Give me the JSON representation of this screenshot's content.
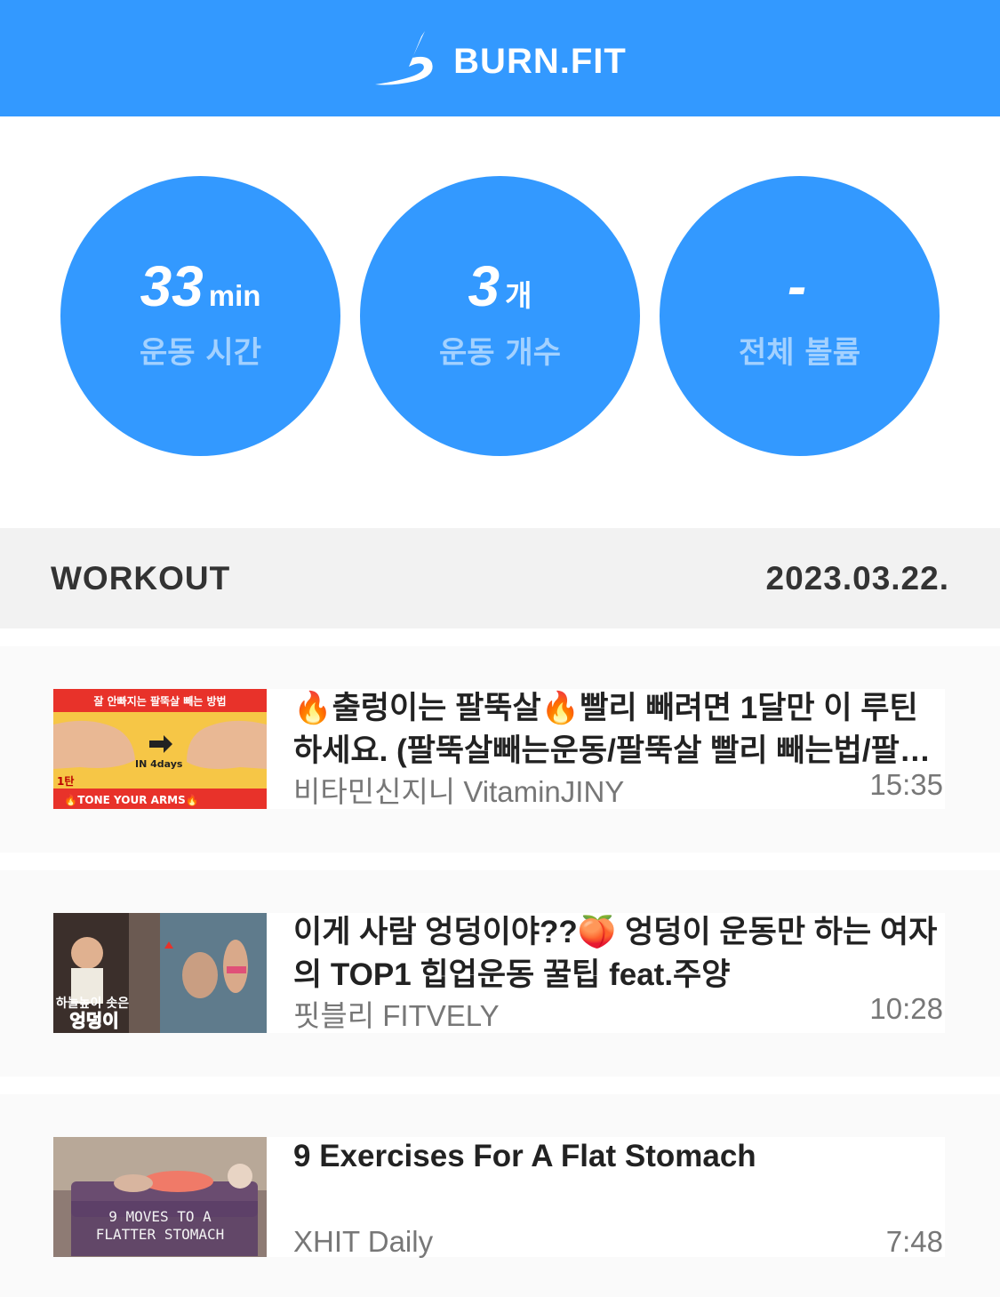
{
  "header": {
    "brand": "BURN.FIT",
    "logo_icon": "burnfit-logo-icon",
    "color": "#3399ff"
  },
  "stats": [
    {
      "value": "33",
      "unit": "min",
      "label": "운동 시간"
    },
    {
      "value": "3",
      "unit": "개",
      "label": "운동 개수"
    },
    {
      "value": "-",
      "unit": "",
      "label": "전체 볼륨"
    }
  ],
  "section": {
    "title": "WORKOUT",
    "date": "2023.03.22."
  },
  "videos": [
    {
      "title": "🔥출렁이는 팔뚝살🔥빨리 빼려면 1달만 이 루틴 하세요. (팔뚝살빼는운동/팔뚝살 빨리 빼는법/팔뚝살 빼는 방법)",
      "channel": "비타민신지니 VitaminJINY",
      "duration": "15:35",
      "thumb": {
        "top_text": "잘 안빠지는 팔뚝살 빼는 방법",
        "middle_text": "IN 4days",
        "badge": "1탄",
        "bottom_text": "🔥TONE YOUR ARMS🔥"
      }
    },
    {
      "title": "이게 사람 엉덩이야??🍑 엉덩이 운동만 하는 여자의 TOP1 힙업운동 꿀팁 feat.주양",
      "channel": "핏블리 FITVELY",
      "duration": "10:28",
      "thumb": {
        "line1": "하늘높이 솟은",
        "line2": "엉덩이"
      }
    },
    {
      "title": "9 Exercises For A Flat Stomach",
      "channel": "XHIT Daily",
      "duration": "7:48",
      "thumb": {
        "line1": "9 MOVES TO A",
        "line2": "FLATTER STOMACH"
      }
    }
  ]
}
